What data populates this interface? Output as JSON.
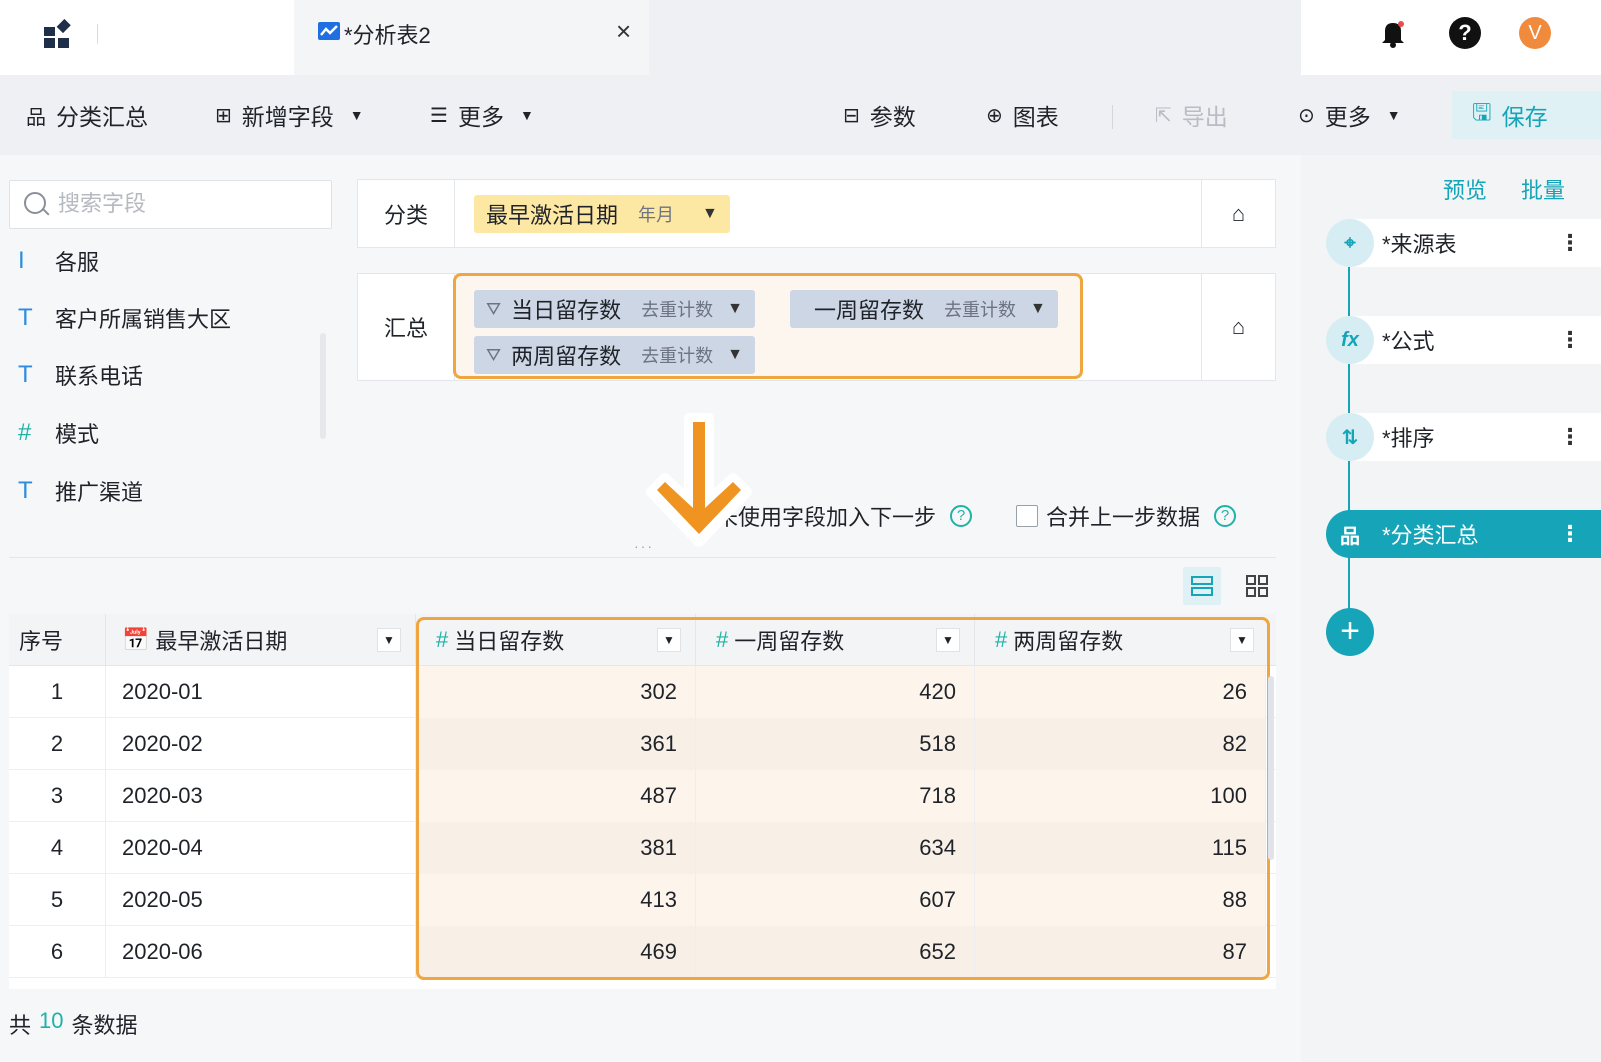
{
  "header": {
    "tab_title": "*分析表2",
    "close_glyph": "×",
    "avatar_letter": "V",
    "help_glyph": "?"
  },
  "toolbar": {
    "group_summary": "分类汇总",
    "add_field": "新增字段",
    "more_left": "更多",
    "params": "参数",
    "chart": "图表",
    "export": "导出",
    "more_right": "更多",
    "save": "保存"
  },
  "fields": {
    "search_placeholder": "搜索字段",
    "items": [
      {
        "type": "I",
        "label": "各服"
      },
      {
        "type": "T",
        "label": "客户所属销售大区"
      },
      {
        "type": "T",
        "label": "联系电话"
      },
      {
        "type": "#",
        "label": "模式"
      },
      {
        "type": "T",
        "label": "推广渠道"
      }
    ]
  },
  "config": {
    "category_label": "分类",
    "category_chip": {
      "name": "最早激活日期",
      "agg": "年月"
    },
    "summary_label": "汇总",
    "summary_chips": [
      {
        "name": "当日留存数",
        "agg": "去重计数"
      },
      {
        "name": "一周留存数",
        "agg": "去重计数"
      },
      {
        "name": "两周留存数",
        "agg": "去重计数"
      }
    ],
    "option_unused": "未使用字段加入下一步",
    "option_merge": "合并上一步数据",
    "qmark": "?"
  },
  "table": {
    "columns": [
      "序号",
      "最早激活日期",
      "当日留存数",
      "一周留存数",
      "两周留存数"
    ],
    "rows": [
      [
        "1",
        "2020-01",
        "302",
        "420",
        "26"
      ],
      [
        "2",
        "2020-02",
        "361",
        "518",
        "82"
      ],
      [
        "3",
        "2020-03",
        "487",
        "718",
        "100"
      ],
      [
        "4",
        "2020-04",
        "381",
        "634",
        "115"
      ],
      [
        "5",
        "2020-05",
        "413",
        "607",
        "88"
      ],
      [
        "6",
        "2020-06",
        "469",
        "652",
        "87"
      ]
    ],
    "footer_prefix": "共",
    "footer_count": "10",
    "footer_suffix": "条数据"
  },
  "flow": {
    "preview": "预览",
    "batch": "批量",
    "steps": [
      {
        "label": "*来源表",
        "icon": "source-icon"
      },
      {
        "label": "*公式",
        "icon": "formula-icon"
      },
      {
        "label": "*排序",
        "icon": "sort-icon"
      },
      {
        "label": "*分类汇总",
        "icon": "group-icon",
        "active": true
      }
    ],
    "more_glyph": "⋮",
    "add_glyph": "+"
  },
  "colors": {
    "accent": "#16a5b8",
    "highlight": "#f0a640",
    "category_chip": "#fde8a3",
    "summary_chip": "#cdd6e5"
  }
}
